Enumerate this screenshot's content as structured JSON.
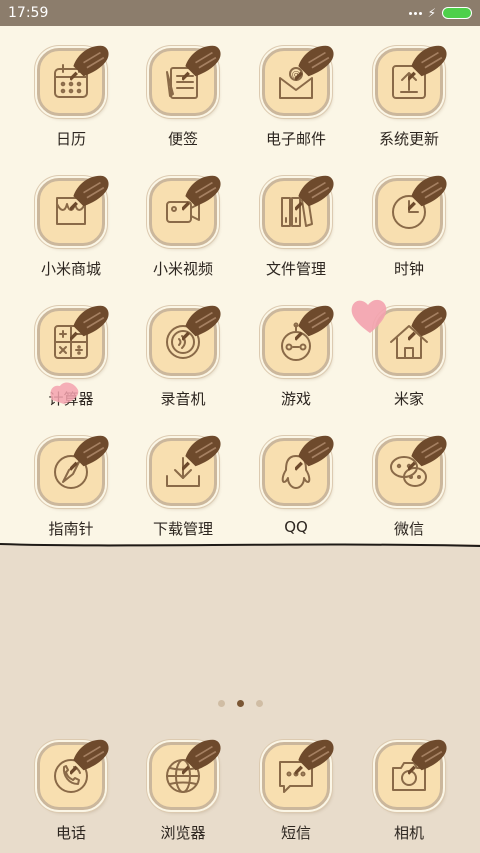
{
  "status_bar": {
    "time": "17:59"
  },
  "apps": [
    {
      "label": "日历",
      "icon": "calendar-icon"
    },
    {
      "label": "便签",
      "icon": "notes-icon"
    },
    {
      "label": "电子邮件",
      "icon": "email-icon"
    },
    {
      "label": "系统更新",
      "icon": "system-update-icon"
    },
    {
      "label": "小米商城",
      "icon": "store-icon"
    },
    {
      "label": "小米视频",
      "icon": "video-icon"
    },
    {
      "label": "文件管理",
      "icon": "file-manager-icon"
    },
    {
      "label": "时钟",
      "icon": "clock-icon"
    },
    {
      "label": "计算器",
      "icon": "calculator-icon"
    },
    {
      "label": "录音机",
      "icon": "recorder-icon"
    },
    {
      "label": "游戏",
      "icon": "game-icon"
    },
    {
      "label": "米家",
      "icon": "home-icon"
    },
    {
      "label": "指南针",
      "icon": "compass-icon"
    },
    {
      "label": "下载管理",
      "icon": "download-icon"
    },
    {
      "label": "QQ",
      "icon": "qq-icon"
    },
    {
      "label": "微信",
      "icon": "wechat-icon"
    }
  ],
  "page_indicator": {
    "count": 3,
    "active": 2
  },
  "dock": [
    {
      "label": "电话",
      "icon": "phone-icon"
    },
    {
      "label": "浏览器",
      "icon": "browser-icon"
    },
    {
      "label": "短信",
      "icon": "sms-icon"
    },
    {
      "label": "相机",
      "icon": "camera-icon"
    }
  ],
  "colors": {
    "paper": "#fbf6e6",
    "wallpaper": "#e8dccb",
    "tile": "#f8dfb0",
    "icon_stroke": "#8a6a48",
    "pin": "#7a5634",
    "heart": "#f09aa8"
  }
}
